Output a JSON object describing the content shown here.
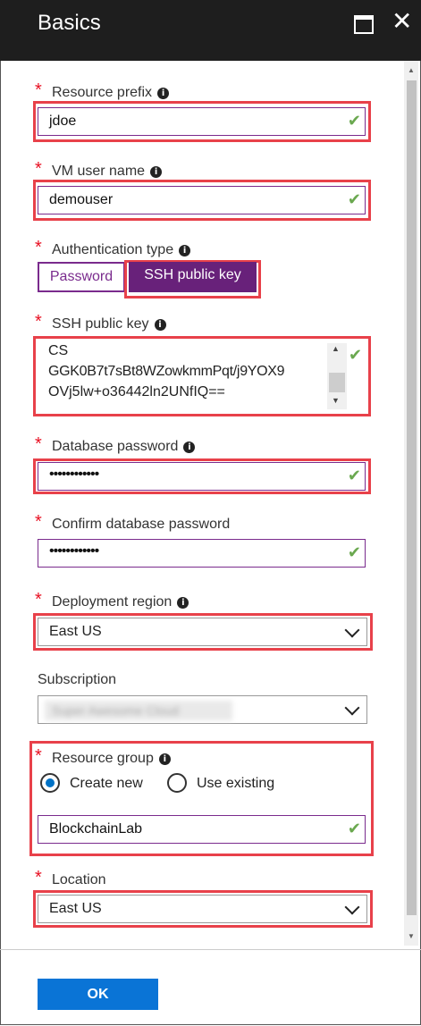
{
  "window": {
    "title": "Basics"
  },
  "resource_prefix": {
    "label": "Resource prefix",
    "value": "jdoe"
  },
  "vm_user_name": {
    "label": "VM user name",
    "value": "demouser"
  },
  "auth_type": {
    "label": "Authentication type",
    "options": [
      "Password",
      "SSH public key"
    ],
    "selected": "SSH public key"
  },
  "ssh_key": {
    "label": "SSH public key",
    "lines": [
      "CS",
      "GGK0B7t7sBt8WZowkmmPqt/j9YOX9",
      "OVj5lw+o36442ln2UNfIQ=="
    ]
  },
  "db_password": {
    "label": "Database password",
    "value": "••••••••••••"
  },
  "confirm_db_password": {
    "label": "Confirm database password",
    "value": "••••••••••••"
  },
  "deployment_region": {
    "label": "Deployment region",
    "value": "East US"
  },
  "subscription": {
    "label": "Subscription",
    "value": "Super Awesome Cloud"
  },
  "resource_group": {
    "label": "Resource group",
    "option_new": "Create new",
    "option_existing": "Use existing",
    "selected": "Create new",
    "value": "BlockchainLab"
  },
  "location": {
    "label": "Location",
    "value": "East US"
  },
  "ok_button": "OK",
  "colors": {
    "accent": "#7a2b8d",
    "highlight": "#e8414a",
    "valid": "#6aa84f",
    "primary": "#0a74d6"
  }
}
